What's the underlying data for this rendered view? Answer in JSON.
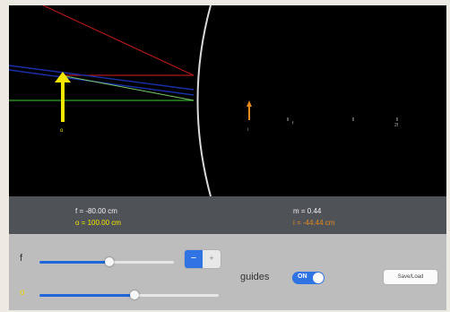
{
  "readout": {
    "focal_length": "f = -80.00 cm",
    "object_distance": "o = 100.00 cm",
    "magnification": "m = 0.44",
    "image_distance": "i = -44.44 cm"
  },
  "canvas": {
    "object_tick_label": "o",
    "image_tick_label": "i",
    "tick_labels": [
      "f",
      "2f"
    ]
  },
  "controls": {
    "f_label": "f",
    "o_label": "o",
    "f_slider_fraction": 0.52,
    "o_slider_fraction": 0.53,
    "stepper_minus": "−",
    "stepper_plus": "+",
    "guides_label": "guides",
    "guides_toggle": "ON",
    "save_load_label": "Save/Load"
  },
  "colors": {
    "background": "#000000",
    "object_arrow": "#f3e600",
    "image_arrow": "#e58a1f",
    "ray_red": "#b01818",
    "ray_blue": "#1a2fa8",
    "ray_green": "#2ea82e",
    "mirror": "#d9d9d9",
    "accent_blue": "#2f74e2"
  }
}
